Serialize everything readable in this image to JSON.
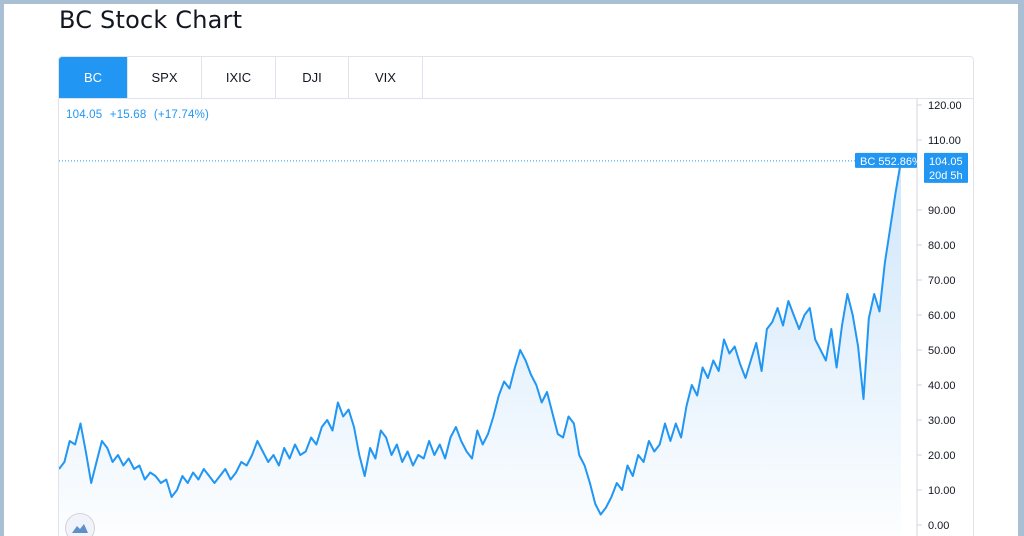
{
  "page": {
    "title": "BC Stock Chart"
  },
  "tabs": [
    {
      "label": "BC",
      "active": true
    },
    {
      "label": "SPX",
      "active": false
    },
    {
      "label": "IXIC",
      "active": false
    },
    {
      "label": "DJI",
      "active": false
    },
    {
      "label": "VIX",
      "active": false
    }
  ],
  "legend": {
    "price": "104.05",
    "change": "+15.68",
    "change_pct": "(+17.74%)"
  },
  "price_tags": {
    "series_label": "BC 552.86%",
    "price": "104.05",
    "countdown": "20d 5h"
  },
  "colors": {
    "accent": "#2196f3",
    "line": "#2196f3",
    "fill_top": "#cfe6fb",
    "fill_bottom": "#ffffff"
  },
  "icons": {
    "logo": "tradingview-logo-icon"
  },
  "chart_data": {
    "type": "area",
    "ylim": [
      0,
      120
    ],
    "yticks": [
      "0.00",
      "10.00",
      "20.00",
      "30.00",
      "40.00",
      "50.00",
      "60.00",
      "70.00",
      "80.00",
      "90.00",
      "110.00",
      "120.00"
    ],
    "grid": false,
    "last_value": 104.05,
    "values": [
      16,
      18,
      24,
      23,
      29,
      21,
      12,
      18,
      24,
      22,
      18,
      20,
      17,
      19,
      16,
      17,
      13,
      15,
      14,
      12,
      13,
      8,
      10,
      14,
      12,
      15,
      13,
      16,
      14,
      12,
      14,
      16,
      13,
      15,
      18,
      17,
      20,
      24,
      21,
      18,
      20,
      17,
      22,
      19,
      23,
      20,
      21,
      25,
      23,
      28,
      30,
      27,
      35,
      31,
      33,
      28,
      20,
      14,
      22,
      19,
      27,
      25,
      20,
      23,
      18,
      21,
      17,
      20,
      19,
      24,
      20,
      23,
      19,
      25,
      28,
      24,
      21,
      19,
      27,
      23,
      26,
      31,
      37,
      41,
      39,
      45,
      50,
      47,
      43,
      40,
      35,
      38,
      32,
      26,
      25,
      31,
      29,
      20,
      17,
      12,
      6,
      3,
      5,
      8,
      12,
      10,
      17,
      14,
      20,
      18,
      24,
      21,
      23,
      29,
      24,
      29,
      25,
      34,
      40,
      37,
      45,
      42,
      47,
      44,
      53,
      49,
      51,
      46,
      42,
      47,
      52,
      44,
      56,
      58,
      62,
      57,
      64,
      60,
      56,
      60,
      62,
      53,
      50,
      47,
      56,
      45,
      57,
      66,
      60,
      51,
      36,
      59,
      66,
      61,
      75,
      85,
      95,
      104.05
    ]
  }
}
